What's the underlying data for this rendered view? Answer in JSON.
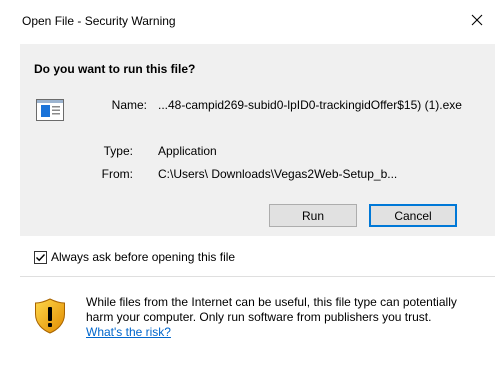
{
  "window": {
    "title": "Open File - Security Warning"
  },
  "dialog": {
    "question": "Do you want to run this file?",
    "fields": {
      "name_label": "Name:",
      "name_value": "...48-campid269-subid0-lpID0-trackingidOffer$15) (1).exe",
      "type_label": "Type:",
      "type_value": "Application",
      "from_label": "From:",
      "from_value": "C:\\Users\\ Downloads\\Vegas2Web-Setup_b..."
    },
    "buttons": {
      "run": "Run",
      "cancel": "Cancel"
    },
    "checkbox": {
      "label": "Always ask before opening this file",
      "checked": true
    },
    "warning": {
      "text": "While files from the Internet can be useful, this file type can potentially harm your computer. Only run software from publishers you trust.",
      "link": "What's the risk?"
    }
  },
  "colors": {
    "accent": "#0078d7",
    "link": "#0066cc",
    "panel": "#f0f0f0"
  },
  "icons": [
    "close-icon",
    "application-icon",
    "checkmark-icon",
    "security-shield-icon"
  ]
}
